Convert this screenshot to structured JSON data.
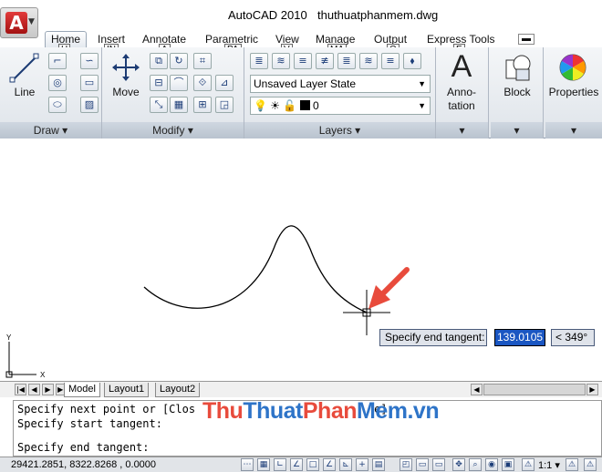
{
  "titlebar": {
    "app_title": "AutoCAD 2010",
    "doc_name": "thuthuatphanmem.dwg",
    "app_logo": "A"
  },
  "tabs": [
    {
      "label": "Home",
      "key": "H"
    },
    {
      "label": "Insert",
      "key": "IN"
    },
    {
      "label": "Annotate",
      "key": "A"
    },
    {
      "label": "Parametric",
      "key": "PA"
    },
    {
      "label": "View",
      "key": "V"
    },
    {
      "label": "Manage",
      "key": "MA"
    },
    {
      "label": "Output",
      "key": "O"
    },
    {
      "label": "Express Tools",
      "key": "E"
    }
  ],
  "ribbon": {
    "draw": {
      "title": "Draw",
      "line_label": "Line"
    },
    "modify": {
      "title": "Modify",
      "move_label": "Move"
    },
    "layers": {
      "title": "Layers",
      "layer_state": "Unsaved Layer State",
      "current_layer": "0"
    },
    "annotation": {
      "label_line1": "Anno-",
      "label_line2": "tation"
    },
    "block": {
      "label": "Block"
    },
    "properties": {
      "label": "Properties"
    }
  },
  "drawing": {
    "prompt": "Specify end tangent:",
    "value": "139.0105",
    "angle": "< 349°",
    "ucs_x": "X",
    "ucs_y": "Y"
  },
  "layout_tabs": [
    "Model",
    "Layout1",
    "Layout2"
  ],
  "command_window": {
    "line1": "Specify next point or [Clos",
    "line1_tail": "e]:",
    "line2": "Specify start tangent:",
    "line3": "Specify end tangent:"
  },
  "watermark": {
    "part1": "Thu",
    "part2": "Thuat",
    "part3": "Phan",
    "part4": "Mem",
    "part5": ".vn"
  },
  "statusbar": {
    "coords": "29421.2851, 8322.8268 , 0.0000",
    "scale": "1:1"
  },
  "colors": {
    "accent_red": "#e84b3c",
    "tip_blue": "#1a56c2",
    "ribbon_top": "#f4f6f8"
  }
}
